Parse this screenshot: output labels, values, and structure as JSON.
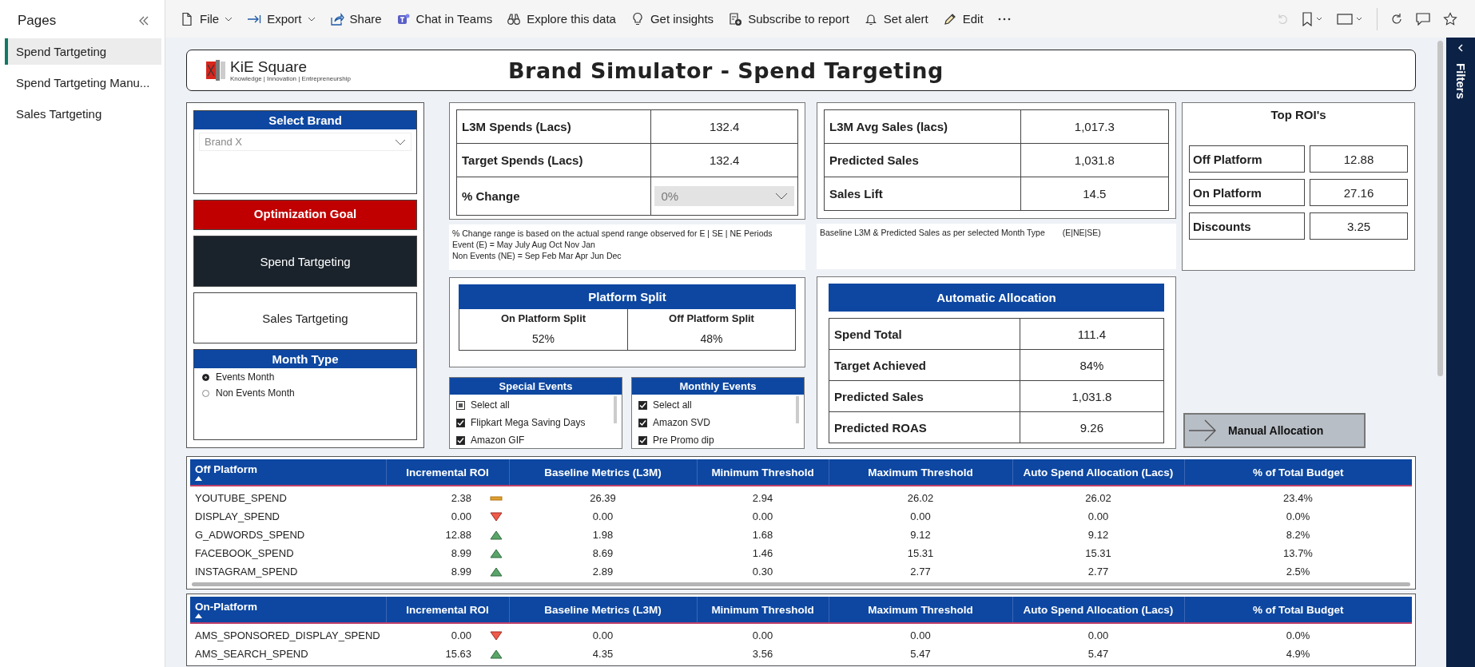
{
  "sidebar": {
    "title": "Pages",
    "items": [
      {
        "label": "Spend Tartgeting",
        "selected": true
      },
      {
        "label": "Spend Tartgeting Manu...",
        "selected": false
      },
      {
        "label": "Sales Tartgeting",
        "selected": false
      }
    ]
  },
  "toolbar": {
    "items": [
      {
        "label": "File",
        "dropdown": true
      },
      {
        "label": "Export",
        "dropdown": true
      },
      {
        "label": "Share",
        "dropdown": false
      },
      {
        "label": "Chat in Teams",
        "dropdown": false
      },
      {
        "label": "Explore this data",
        "dropdown": false
      },
      {
        "label": "Get insights",
        "dropdown": false
      },
      {
        "label": "Subscribe to report",
        "dropdown": false
      },
      {
        "label": "Set alert",
        "dropdown": false
      },
      {
        "label": "Edit",
        "dropdown": false
      }
    ]
  },
  "filters_pane": {
    "label": "Filters"
  },
  "header": {
    "logo_name": "KiE Square",
    "logo_tagline": "Knowledge | Innovation | Entrepreneurship",
    "title": "Brand Simulator - Spend Targeting"
  },
  "select_brand": {
    "title": "Select Brand",
    "value": "Brand X"
  },
  "optimization_goal": {
    "title": "Optimization Goal",
    "options": [
      {
        "label": "Spend Tartgeting",
        "selected": true
      },
      {
        "label": "Sales Tartgeting",
        "selected": false
      }
    ]
  },
  "month_type": {
    "title": "Month Type",
    "options": [
      {
        "label": "Events Month",
        "selected": true
      },
      {
        "label": "Non Events Month",
        "selected": false
      }
    ]
  },
  "spend_kpis": [
    {
      "label": "L3M Spends (Lacs)",
      "value": "132.4",
      "kind": "value"
    },
    {
      "label": "Target Spends (Lacs)",
      "value": "132.4",
      "kind": "value"
    },
    {
      "label": "% Change",
      "value": "0%",
      "kind": "dropdown"
    }
  ],
  "spend_note": [
    "% Change range is based on the actual spend range observed for E | SE | NE  Periods",
    "Event (E) =  May July Aug Oct Nov Jan",
    "Non Events (NE) = Sep Feb Mar Apr Jun Dec"
  ],
  "sales_kpis": [
    {
      "label": "L3M Avg Sales (lacs)",
      "value": "1,017.3",
      "kind": "value"
    },
    {
      "label": "Predicted Sales",
      "value": "1,031.8",
      "kind": "value"
    },
    {
      "label": "Sales Lift",
      "value": "14.5",
      "kind": "value"
    }
  ],
  "sales_note": [
    "Baseline L3M & Predicted Sales as per selected Month Type",
    "(E|NE|SE)"
  ],
  "platform_split": {
    "title": "Platform Split",
    "columns": [
      {
        "label": "On Platform Split",
        "value": "52%"
      },
      {
        "label": "Off Platform Split",
        "value": "48%"
      }
    ]
  },
  "special_events": {
    "title": "Special Events",
    "items": [
      {
        "label": "Select all",
        "kind": "partial"
      },
      {
        "label": "Flipkart Mega Saving Days",
        "kind": "checked"
      },
      {
        "label": "Amazon GIF",
        "kind": "checked"
      }
    ]
  },
  "monthly_events": {
    "title": "Monthly Events",
    "items": [
      {
        "label": "Select all",
        "kind": "checked"
      },
      {
        "label": "Amazon SVD",
        "kind": "checked"
      },
      {
        "label": "Pre Promo dip",
        "kind": "checked"
      }
    ]
  },
  "automatic_allocation": {
    "title": "Automatic Allocation",
    "rows": [
      {
        "label": "Spend Total",
        "value": "111.4"
      },
      {
        "label": "Target Achieved",
        "value": "84%"
      },
      {
        "label": "Predicted Sales",
        "value": "1,031.8"
      },
      {
        "label": "Predicted ROAS",
        "value": "9.26"
      }
    ]
  },
  "top_rois": {
    "title": "Top ROI's",
    "rows": [
      {
        "label": "Off Platform",
        "value": "12.88"
      },
      {
        "label": "On Platform",
        "value": "27.16"
      },
      {
        "label": "Discounts",
        "value": "3.25"
      }
    ]
  },
  "manual_allocation_button": {
    "label": "Manual Allocation"
  },
  "tables": [
    {
      "columns": [
        "Off Platform",
        "Incremental ROI",
        "Baseline Metrics (L3M)",
        "Minimum Threshold",
        "Maximum Threshold",
        "Auto Spend Allocation (Lacs)",
        "% of Total Budget"
      ],
      "rows": [
        {
          "cells": [
            "YOUTUBE_SPEND",
            "2.38",
            "26.39",
            "2.94",
            "26.02",
            "26.02",
            "23.4%"
          ],
          "kind": "flat"
        },
        {
          "cells": [
            "DISPLAY_SPEND",
            "0.00",
            "0.00",
            "0.00",
            "0.00",
            "0.00",
            "0.0%"
          ],
          "kind": "down"
        },
        {
          "cells": [
            "G_ADWORDS_SPEND",
            "12.88",
            "1.98",
            "1.68",
            "9.12",
            "9.12",
            "8.2%"
          ],
          "kind": "up"
        },
        {
          "cells": [
            "FACEBOOK_SPEND",
            "8.99",
            "8.69",
            "1.46",
            "15.31",
            "15.31",
            "13.7%"
          ],
          "kind": "up"
        },
        {
          "cells": [
            "INSTAGRAM_SPEND",
            "8.99",
            "2.89",
            "0.30",
            "2.77",
            "2.77",
            "2.5%"
          ],
          "kind": "up"
        }
      ]
    },
    {
      "columns": [
        "On-Platform",
        "Incremental ROI",
        "Baseline Metrics (L3M)",
        "Minimum Threshold",
        "Maximum Threshold",
        "Auto Spend Allocation (Lacs)",
        "% of Total Budget"
      ],
      "rows": [
        {
          "cells": [
            "AMS_SPONSORED_DISPLAY_SPEND",
            "0.00",
            "0.00",
            "0.00",
            "0.00",
            "0.00",
            "0.0%"
          ],
          "kind": "down"
        },
        {
          "cells": [
            "AMS_SEARCH_SPEND",
            "15.63",
            "4.35",
            "3.56",
            "5.47",
            "5.47",
            "4.9%"
          ],
          "kind": "up"
        }
      ]
    }
  ]
}
